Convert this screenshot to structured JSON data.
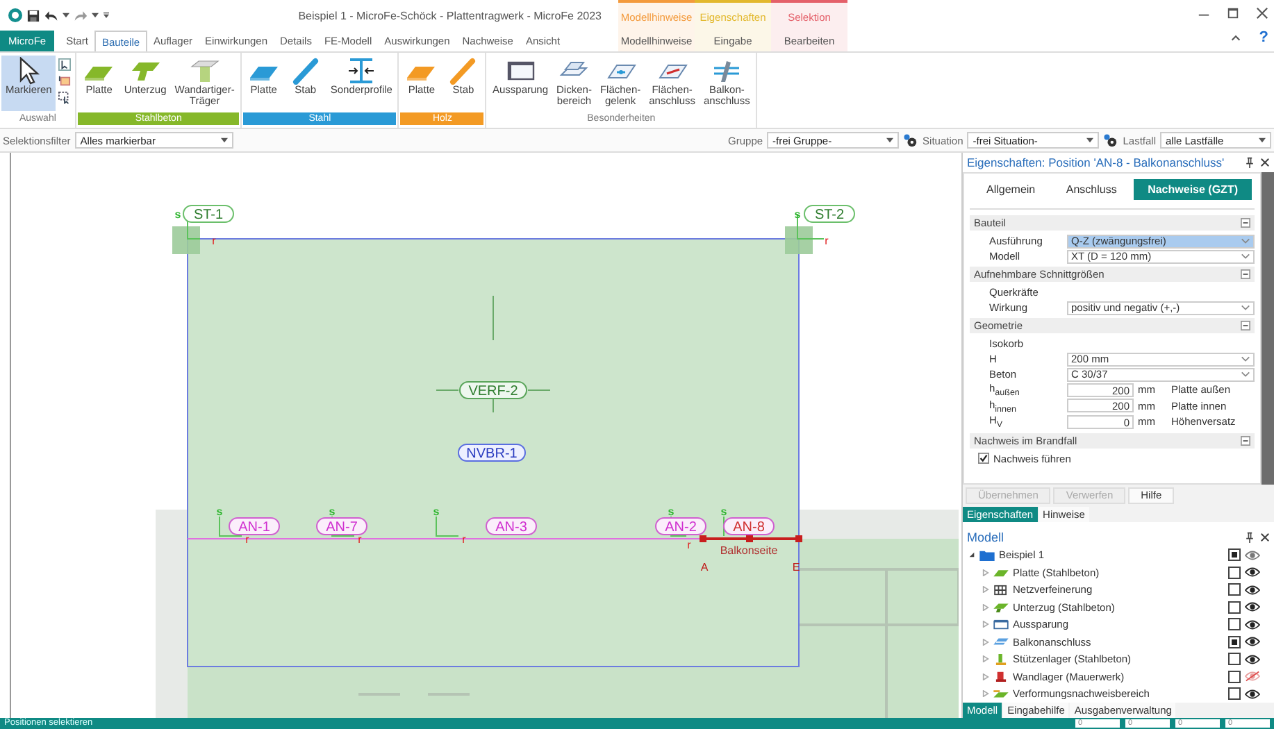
{
  "title_bar": {
    "title": "Beispiel 1 - MicroFe-Schöck - Plattentragwerk - MicroFe 2023",
    "help": "?"
  },
  "ribbon_tabs": [
    {
      "label": "MicroFe",
      "kind": "app",
      "selected": false
    },
    {
      "label": "Start",
      "kind": "main",
      "selected": false
    },
    {
      "label": "Bauteile",
      "kind": "main",
      "selected": true
    },
    {
      "label": "Auflager",
      "kind": "main",
      "selected": false
    },
    {
      "label": "Einwirkungen",
      "kind": "main",
      "selected": false
    },
    {
      "label": "Details",
      "kind": "main",
      "selected": false
    },
    {
      "label": "FE-Modell",
      "kind": "main",
      "selected": false
    },
    {
      "label": "Auswirkungen",
      "kind": "main",
      "selected": false
    },
    {
      "label": "Nachweise",
      "kind": "main",
      "selected": false
    },
    {
      "label": "Ansicht",
      "kind": "main",
      "selected": false
    }
  ],
  "context_tabs": [
    {
      "group": "Modellhinweise",
      "label": "Modellhinweise",
      "color": "#f39a3c"
    },
    {
      "group": "Eigenschaften",
      "label": "Eingabe",
      "color": "#e2b82c"
    },
    {
      "group": "Selektion",
      "label": "Bearbeiten",
      "color": "#e4606a"
    }
  ],
  "ribbon_groups": [
    {
      "label": "Auswahl",
      "kind": "selection",
      "buttons": [
        {
          "label": "Markieren",
          "selected": true
        }
      ]
    },
    {
      "label": "Stahlbeton",
      "kind": "material",
      "color": "#86b82a",
      "buttons": [
        {
          "label": "Platte",
          "selected": false
        },
        {
          "label": "Unterzug",
          "selected": false
        },
        {
          "label": "Wandartiger-\nTräger",
          "selected": false
        }
      ]
    },
    {
      "label": "Stahl",
      "kind": "material",
      "color": "#2a9ad6",
      "buttons": [
        {
          "label": "Platte",
          "selected": false
        },
        {
          "label": "Stab",
          "selected": false
        },
        {
          "label": "Sonderprofile",
          "selected": false
        }
      ]
    },
    {
      "label": "Holz",
      "kind": "material",
      "color": "#f39a24",
      "buttons": [
        {
          "label": "Platte",
          "selected": false
        },
        {
          "label": "Stab",
          "selected": false
        }
      ]
    },
    {
      "label": "Besonderheiten",
      "kind": "special",
      "buttons": [
        {
          "label": "Aussparung",
          "selected": false
        },
        {
          "label": "Dicken-\nbereich",
          "selected": false
        },
        {
          "label": "Flächen-\ngelenk",
          "selected": false
        },
        {
          "label": "Flächen-\nanschluss",
          "selected": false
        },
        {
          "label": "Balkon-\nanschluss",
          "selected": false
        }
      ]
    }
  ],
  "filter_bar": {
    "selection_filter": {
      "label": "Selektionsfilter",
      "value": "Alles markierbar"
    },
    "group": {
      "label": "Gruppe",
      "value": "-frei Gruppe-"
    },
    "situation": {
      "label": "Situation",
      "value": "-frei Situation-"
    },
    "load_case": {
      "label": "Lastfall",
      "value": "alle Lastfälle"
    }
  },
  "canvas": {
    "labels": [
      {
        "text": "ST-1",
        "kind": "support",
        "selected": false
      },
      {
        "text": "ST-2",
        "kind": "support",
        "selected": false
      },
      {
        "text": "VERF-2",
        "kind": "area",
        "selected": false
      },
      {
        "text": "NVBR-1",
        "kind": "region",
        "selected": false
      },
      {
        "text": "AN-1",
        "kind": "connection",
        "selected": false
      },
      {
        "text": "AN-7",
        "kind": "connection",
        "selected": false
      },
      {
        "text": "AN-3",
        "kind": "connection",
        "selected": false
      },
      {
        "text": "AN-2",
        "kind": "connection",
        "selected": false
      },
      {
        "text": "AN-8",
        "kind": "connection",
        "selected": true
      }
    ],
    "annotations": [
      {
        "text": "s",
        "kind": "axis"
      },
      {
        "text": "r",
        "kind": "direction"
      },
      {
        "text": "s",
        "kind": "axis"
      },
      {
        "text": "r",
        "kind": "direction"
      },
      {
        "text": "s",
        "kind": "axis"
      },
      {
        "text": "r",
        "kind": "direction"
      },
      {
        "text": "s",
        "kind": "axis"
      },
      {
        "text": "r",
        "kind": "direction"
      },
      {
        "text": "s",
        "kind": "axis"
      },
      {
        "text": "r",
        "kind": "direction"
      },
      {
        "text": "s",
        "kind": "axis"
      },
      {
        "text": "r",
        "kind": "direction"
      },
      {
        "text": "s",
        "kind": "axis"
      },
      {
        "text": "Balkonseite",
        "kind": "caption"
      },
      {
        "text": "A",
        "kind": "point"
      },
      {
        "text": "E",
        "kind": "point"
      }
    ]
  },
  "properties": {
    "title": "Eigenschaften: Position 'AN-8 - Balkonanschluss'",
    "tabs": [
      {
        "label": "Allgemein",
        "selected": false
      },
      {
        "label": "Anschluss",
        "selected": false
      },
      {
        "label": "Nachweise (GZT)",
        "selected": true
      }
    ],
    "sections": [
      {
        "title": "Bauteil",
        "rows": [
          {
            "kind": "select",
            "label": "Ausführung",
            "value": "Q-Z (zwängungsfrei)",
            "highlighted": true
          },
          {
            "kind": "select",
            "label": "Modell",
            "value": "XT (D = 120 mm)",
            "highlighted": false
          }
        ]
      },
      {
        "title": "Aufnehmbare Schnittgrößen",
        "rows": [
          {
            "kind": "heading",
            "label": "Querkräfte"
          },
          {
            "kind": "select",
            "label": "Wirkung",
            "value": "positiv und negativ (+,-)",
            "highlighted": false
          }
        ]
      },
      {
        "title": "Geometrie",
        "rows": [
          {
            "kind": "heading",
            "label": "Isokorb"
          },
          {
            "kind": "select",
            "label": "H",
            "value": "200 mm",
            "highlighted": false
          },
          {
            "kind": "select",
            "label": "Beton",
            "value": "C 30/37",
            "highlighted": false
          },
          {
            "kind": "number",
            "label": "h$_{außen}$",
            "value": "200",
            "unit": "mm",
            "note": "Platte außen"
          },
          {
            "kind": "number",
            "label": "h$_{innen}$",
            "value": "200",
            "unit": "mm",
            "note": "Platte innen"
          },
          {
            "kind": "number",
            "label": "H$_{V}$",
            "value": "0",
            "unit": "mm",
            "note": "Höhenversatz"
          }
        ]
      },
      {
        "title": "Nachweis im Brandfall",
        "rows": [
          {
            "kind": "checkbox",
            "label": "Nachweis führen",
            "checked": true
          }
        ]
      }
    ],
    "buttons": [
      {
        "label": "Übernehmen",
        "disabled": true
      },
      {
        "label": "Verwerfen",
        "disabled": true
      },
      {
        "label": "Hilfe",
        "disabled": false
      }
    ],
    "panel_tabs": [
      {
        "label": "Eigenschaften",
        "selected": true
      },
      {
        "label": "Hinweise",
        "selected": false
      }
    ]
  },
  "model": {
    "title": "Modell",
    "root": {
      "label": "Beispiel 1",
      "expanded": true,
      "checked": true,
      "visible": true,
      "children": [
        {
          "label": "Platte (Stahlbeton)",
          "checked": false,
          "visible": true
        },
        {
          "label": "Netzverfeinerung",
          "checked": false,
          "visible": true
        },
        {
          "label": "Unterzug (Stahlbeton)",
          "checked": false,
          "visible": true
        },
        {
          "label": "Aussparung",
          "checked": false,
          "visible": true
        },
        {
          "label": "Balkonanschluss",
          "checked": true,
          "visible": true
        },
        {
          "label": "Stützenlager (Stahlbeton)",
          "checked": false,
          "visible": true
        },
        {
          "label": "Wandlager (Mauerwerk)",
          "checked": false,
          "visible": false
        },
        {
          "label": "Verformungsnachweisbereich",
          "checked": false,
          "visible": true
        }
      ]
    },
    "tabs": [
      {
        "label": "Modell",
        "selected": true
      },
      {
        "label": "Eingabehilfe",
        "selected": false
      },
      {
        "label": "Ausgabenverwaltung",
        "selected": false
      }
    ]
  },
  "status_bar": {
    "text": "Positionen selektieren",
    "fields": [
      "0",
      "0",
      "0",
      "0"
    ]
  }
}
